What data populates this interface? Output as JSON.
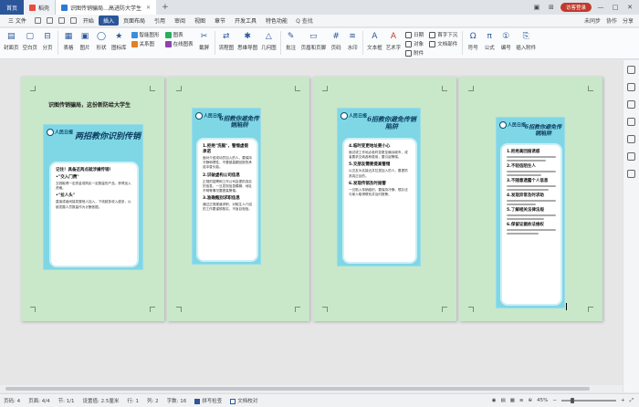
{
  "titlebar": {
    "tabs": [
      {
        "label": "首页"
      },
      {
        "label": "稻壳"
      },
      {
        "label": "识图传销骗局…高进防大学生"
      }
    ],
    "add_tab": "+",
    "login": "访客登录",
    "controls": {
      "minimize": "—",
      "maximize": "□",
      "close": "✕"
    }
  },
  "menubar": {
    "file": "三 文件",
    "items": [
      "开始",
      "插入",
      "页面布局",
      "引用",
      "审阅",
      "视图",
      "章节",
      "开发工具",
      "特色功能"
    ],
    "active": "插入",
    "search": "Q 查找",
    "right": [
      "未同步",
      "协作",
      "分享"
    ]
  },
  "ribbon": {
    "groups": [
      {
        "label": "封面页",
        "icon": "▤"
      },
      {
        "label": "空白页",
        "icon": "▢"
      },
      {
        "label": "分页",
        "icon": "⊟"
      },
      {
        "label": "表格",
        "icon": "▦"
      },
      {
        "label": "图片",
        "icon": "▣"
      },
      {
        "label": "形状",
        "icon": "◯"
      },
      {
        "label": "图标库",
        "icon": "★"
      }
    ],
    "stack1": [
      "智能图形",
      "关系图"
    ],
    "stack2": [
      "图表",
      "在线图表"
    ],
    "more": [
      {
        "label": "截屏",
        "icon": "✂"
      },
      {
        "label": "流程图",
        "icon": "⇄"
      },
      {
        "label": "思维导图",
        "icon": "✱"
      },
      {
        "label": "几何图",
        "icon": "△"
      },
      {
        "label": "批注",
        "icon": "✎"
      },
      {
        "label": "页眉和页脚",
        "icon": "▭"
      },
      {
        "label": "页码",
        "icon": "#"
      },
      {
        "label": "水印",
        "icon": "≋"
      },
      {
        "label": "文本框",
        "icon": "A"
      },
      {
        "label": "艺术字",
        "icon": "A"
      }
    ],
    "stack3": [
      "日期",
      "对象",
      "附件"
    ],
    "stack4": [
      "首字下沉",
      "文档部件"
    ],
    "tail": [
      {
        "label": "符号",
        "icon": "Ω"
      },
      {
        "label": "公式",
        "icon": "π"
      },
      {
        "label": "编号",
        "icon": "①"
      },
      {
        "label": "插入附件",
        "icon": "⎘"
      }
    ]
  },
  "pages": {
    "p1_heading": "识图传销骗局，这份新防给大学生",
    "p1_title": "两招教你识别传销",
    "p1_card": {
      "h1": "记住！具备这两点就涉嫌传销！",
      "b1": "•\"交入门费\"",
      "t1": "交钱取得一定资金或购买一定数量的产品，获得加入资格。",
      "b2": "•\"拉人头\"",
      "t2": "直接或者间接发展他人加入，下线越多收入越多，以被发展人员数量作为计酬依据。"
    },
    "p2_title": "6招教你避免传销陷阱",
    "p2_card": {
      "h1": "1.拒绝\"洗脑\"，警惕虚假承诺",
      "t1": "面对介绍或动员加入的人，要保持冷静和理性，不要被高额回报的承诺冲昏头脑。",
      "h2": "2.识破虚构公司信息",
      "t2": "正规的招聘和工作公司会提供真实的信息，一旦发现信息模糊、地址不明等情况要提高警惕。",
      "h3": "3.准确甄别求职信息",
      "t3": "通过正规渠道求职，对陌生人介绍的工作要谨慎核实，不盲目相信。"
    },
    "p3_title": "6招教你避免传销陷阱",
    "p3_card": {
      "h1": "4.临时变更地址要小心",
      "t1": "面试或工作地点临时变更至偏远城市，或者要求交纳各种费用，要引起警惕。",
      "h2": "5.交朋友需要提高警惕",
      "t2": "以交友为名接近并拉拢加入的人，要提防其真正目的。",
      "h3": "6.发现传销及时报警",
      "t3": "一旦陷入传销组织，要保持冷静，想办法与家人取得联系并及时报警。"
    },
    "p4_title": "6招教你避免传销陷阱",
    "p4_card": {
      "h1": "1.拒绝高回报诱惑",
      "h2": "2.不轻信陌生人",
      "h3": "3.不随意透露个人信息",
      "h4": "4.发现异常及时求助",
      "h5": "5.了解相关法律法规",
      "h6": "6.保留证据依法维权"
    },
    "brand": "人民日报"
  },
  "statusbar": {
    "page_no": "页码: 4",
    "page": "页面: 4/4",
    "section": "节: 1/1",
    "settings": "设置值: 2.5厘米",
    "row": "行: 1",
    "col": "列: 2",
    "words": "字数: 16",
    "spell": "拼写检查",
    "proof": "文档校对",
    "zoom": "45%",
    "zoom_minus": "−",
    "zoom_plus": "+"
  }
}
